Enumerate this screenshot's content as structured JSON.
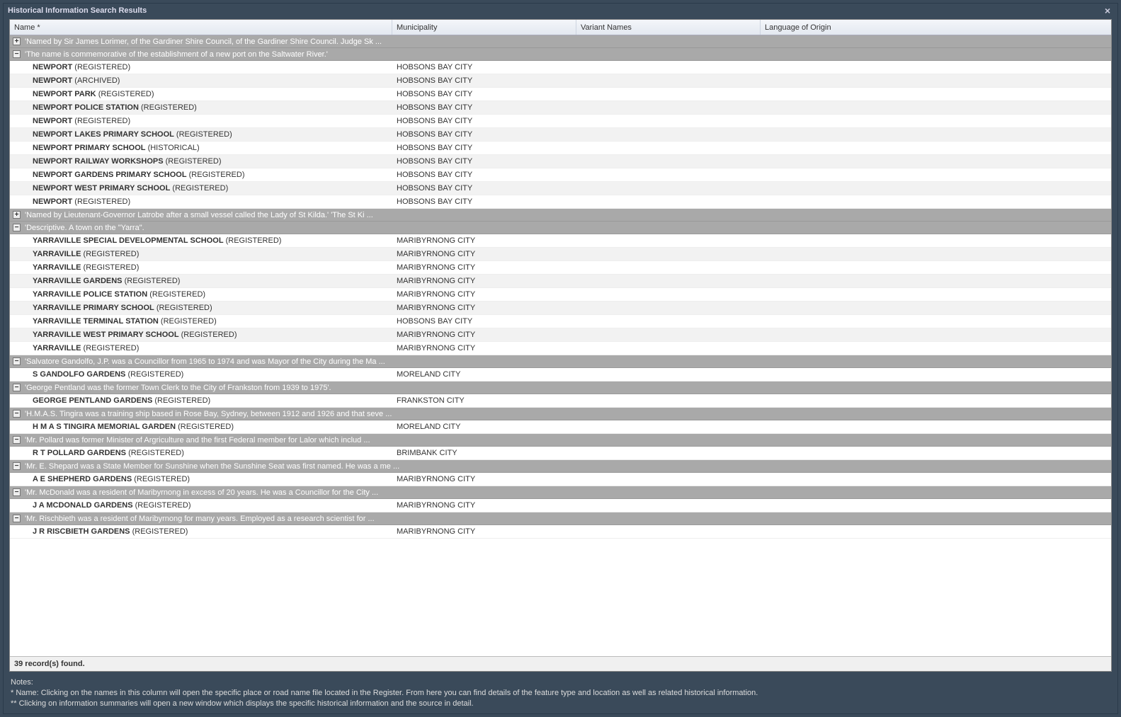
{
  "window": {
    "title": "Historical Information Search Results",
    "close": "×"
  },
  "columns": {
    "name": "Name *",
    "municipality": "Municipality",
    "variant": "Variant Names",
    "language": "Language of Origin"
  },
  "groups": [
    {
      "collapsed": true,
      "label": "'Named by Sir James Lorimer, of the Gardiner Shire Council, of the Gardiner Shire Council. Judge Sk ...",
      "rows": []
    },
    {
      "collapsed": false,
      "label": "'The name is commemorative of the establishment of a new port on the Saltwater River.'",
      "rows": [
        {
          "name": "NEWPORT",
          "status": "(REGISTERED)",
          "muni": "HOBSONS BAY CITY"
        },
        {
          "name": "NEWPORT",
          "status": "(ARCHIVED)",
          "muni": "HOBSONS BAY CITY"
        },
        {
          "name": "NEWPORT PARK",
          "status": "(REGISTERED)",
          "muni": "HOBSONS BAY CITY"
        },
        {
          "name": "NEWPORT POLICE STATION",
          "status": "(REGISTERED)",
          "muni": "HOBSONS BAY CITY"
        },
        {
          "name": "NEWPORT",
          "status": "(REGISTERED)",
          "muni": "HOBSONS BAY CITY"
        },
        {
          "name": "NEWPORT LAKES PRIMARY SCHOOL",
          "status": "(REGISTERED)",
          "muni": "HOBSONS BAY CITY"
        },
        {
          "name": "NEWPORT PRIMARY SCHOOL",
          "status": "(HISTORICAL)",
          "muni": "HOBSONS BAY CITY"
        },
        {
          "name": "NEWPORT RAILWAY WORKSHOPS",
          "status": "(REGISTERED)",
          "muni": "HOBSONS BAY CITY"
        },
        {
          "name": "NEWPORT GARDENS PRIMARY SCHOOL",
          "status": "(REGISTERED)",
          "muni": "HOBSONS BAY CITY"
        },
        {
          "name": "NEWPORT WEST PRIMARY SCHOOL",
          "status": "(REGISTERED)",
          "muni": "HOBSONS BAY CITY"
        },
        {
          "name": "NEWPORT",
          "status": "(REGISTERED)",
          "muni": "HOBSONS BAY CITY"
        }
      ]
    },
    {
      "collapsed": true,
      "label": "'Named by Lieutenant-Governor Latrobe after a small vessel called the Lady of St Kilda.' 'The St Ki ...",
      "rows": []
    },
    {
      "collapsed": false,
      "label": "'Descriptive. A town on the \"Yarra\".",
      "rows": [
        {
          "name": "YARRAVILLE SPECIAL DEVELOPMENTAL SCHOOL",
          "status": "(REGISTERED)",
          "muni": "MARIBYRNONG CITY"
        },
        {
          "name": "YARRAVILLE",
          "status": "(REGISTERED)",
          "muni": "MARIBYRNONG CITY"
        },
        {
          "name": "YARRAVILLE",
          "status": "(REGISTERED)",
          "muni": "MARIBYRNONG CITY"
        },
        {
          "name": "YARRAVILLE GARDENS",
          "status": "(REGISTERED)",
          "muni": "MARIBYRNONG CITY"
        },
        {
          "name": "YARRAVILLE POLICE STATION",
          "status": "(REGISTERED)",
          "muni": "MARIBYRNONG CITY"
        },
        {
          "name": "YARRAVILLE PRIMARY SCHOOL",
          "status": "(REGISTERED)",
          "muni": "MARIBYRNONG CITY"
        },
        {
          "name": "YARRAVILLE TERMINAL STATION",
          "status": "(REGISTERED)",
          "muni": "HOBSONS BAY CITY"
        },
        {
          "name": "YARRAVILLE WEST PRIMARY SCHOOL",
          "status": "(REGISTERED)",
          "muni": "MARIBYRNONG CITY"
        },
        {
          "name": "YARRAVILLE",
          "status": "(REGISTERED)",
          "muni": "MARIBYRNONG CITY"
        }
      ]
    },
    {
      "collapsed": false,
      "label": "'Salvatore Gandolfo, J.P. was a Councillor from 1965 to 1974 and was Mayor of the City during the Ma ...",
      "rows": [
        {
          "name": "S GANDOLFO GARDENS",
          "status": "(REGISTERED)",
          "muni": "MORELAND CITY"
        }
      ]
    },
    {
      "collapsed": false,
      "label": "'George Pentland was the former Town Clerk to the City of Frankston from 1939 to 1975'.",
      "rows": [
        {
          "name": "GEORGE PENTLAND GARDENS",
          "status": "(REGISTERED)",
          "muni": "FRANKSTON CITY"
        }
      ]
    },
    {
      "collapsed": false,
      "label": "'H.M.A.S. Tingira was a training ship based in Rose Bay, Sydney, between 1912 and 1926 and that seve ...",
      "rows": [
        {
          "name": "H M A S TINGIRA MEMORIAL GARDEN",
          "status": "(REGISTERED)",
          "muni": "MORELAND CITY"
        }
      ]
    },
    {
      "collapsed": false,
      "label": "'Mr. Pollard was former Minister of Argriculture and the first Federal member for Lalor which includ ...",
      "rows": [
        {
          "name": "R T POLLARD GARDENS",
          "status": "(REGISTERED)",
          "muni": "BRIMBANK CITY"
        }
      ]
    },
    {
      "collapsed": false,
      "label": "'Mr. E. Shepard was a State Member for Sunshine when the Sunshine Seat was first named. He was a me ...",
      "rows": [
        {
          "name": "A E SHEPHERD GARDENS",
          "status": "(REGISTERED)",
          "muni": "MARIBYRNONG CITY"
        }
      ]
    },
    {
      "collapsed": false,
      "label": "'Mr. McDonald was a resident of Maribyrnong in excess of 20 years. He was a Councillor for the City ...",
      "rows": [
        {
          "name": "J A MCDONALD GARDENS",
          "status": "(REGISTERED)",
          "muni": "MARIBYRNONG CITY"
        }
      ]
    },
    {
      "collapsed": false,
      "label": "'Mr. Rischbieth was a resident of Maribyrnong for many years. Employed as a research scientist for ...",
      "rows": [
        {
          "name": "J R RISCBIETH GARDENS",
          "status": "(REGISTERED)",
          "muni": "MARIBYRNONG CITY"
        }
      ]
    }
  ],
  "status": "39 record(s) found.",
  "notes": {
    "heading": "Notes:",
    "line1": "* Name: Clicking on the names in this column will open the specific place or road name file located in the Register. From here you can find details of the feature type and location as well as related historical information.",
    "line2": "** Clicking on information summaries will open a new window which displays the specific historical information and the source in detail."
  }
}
